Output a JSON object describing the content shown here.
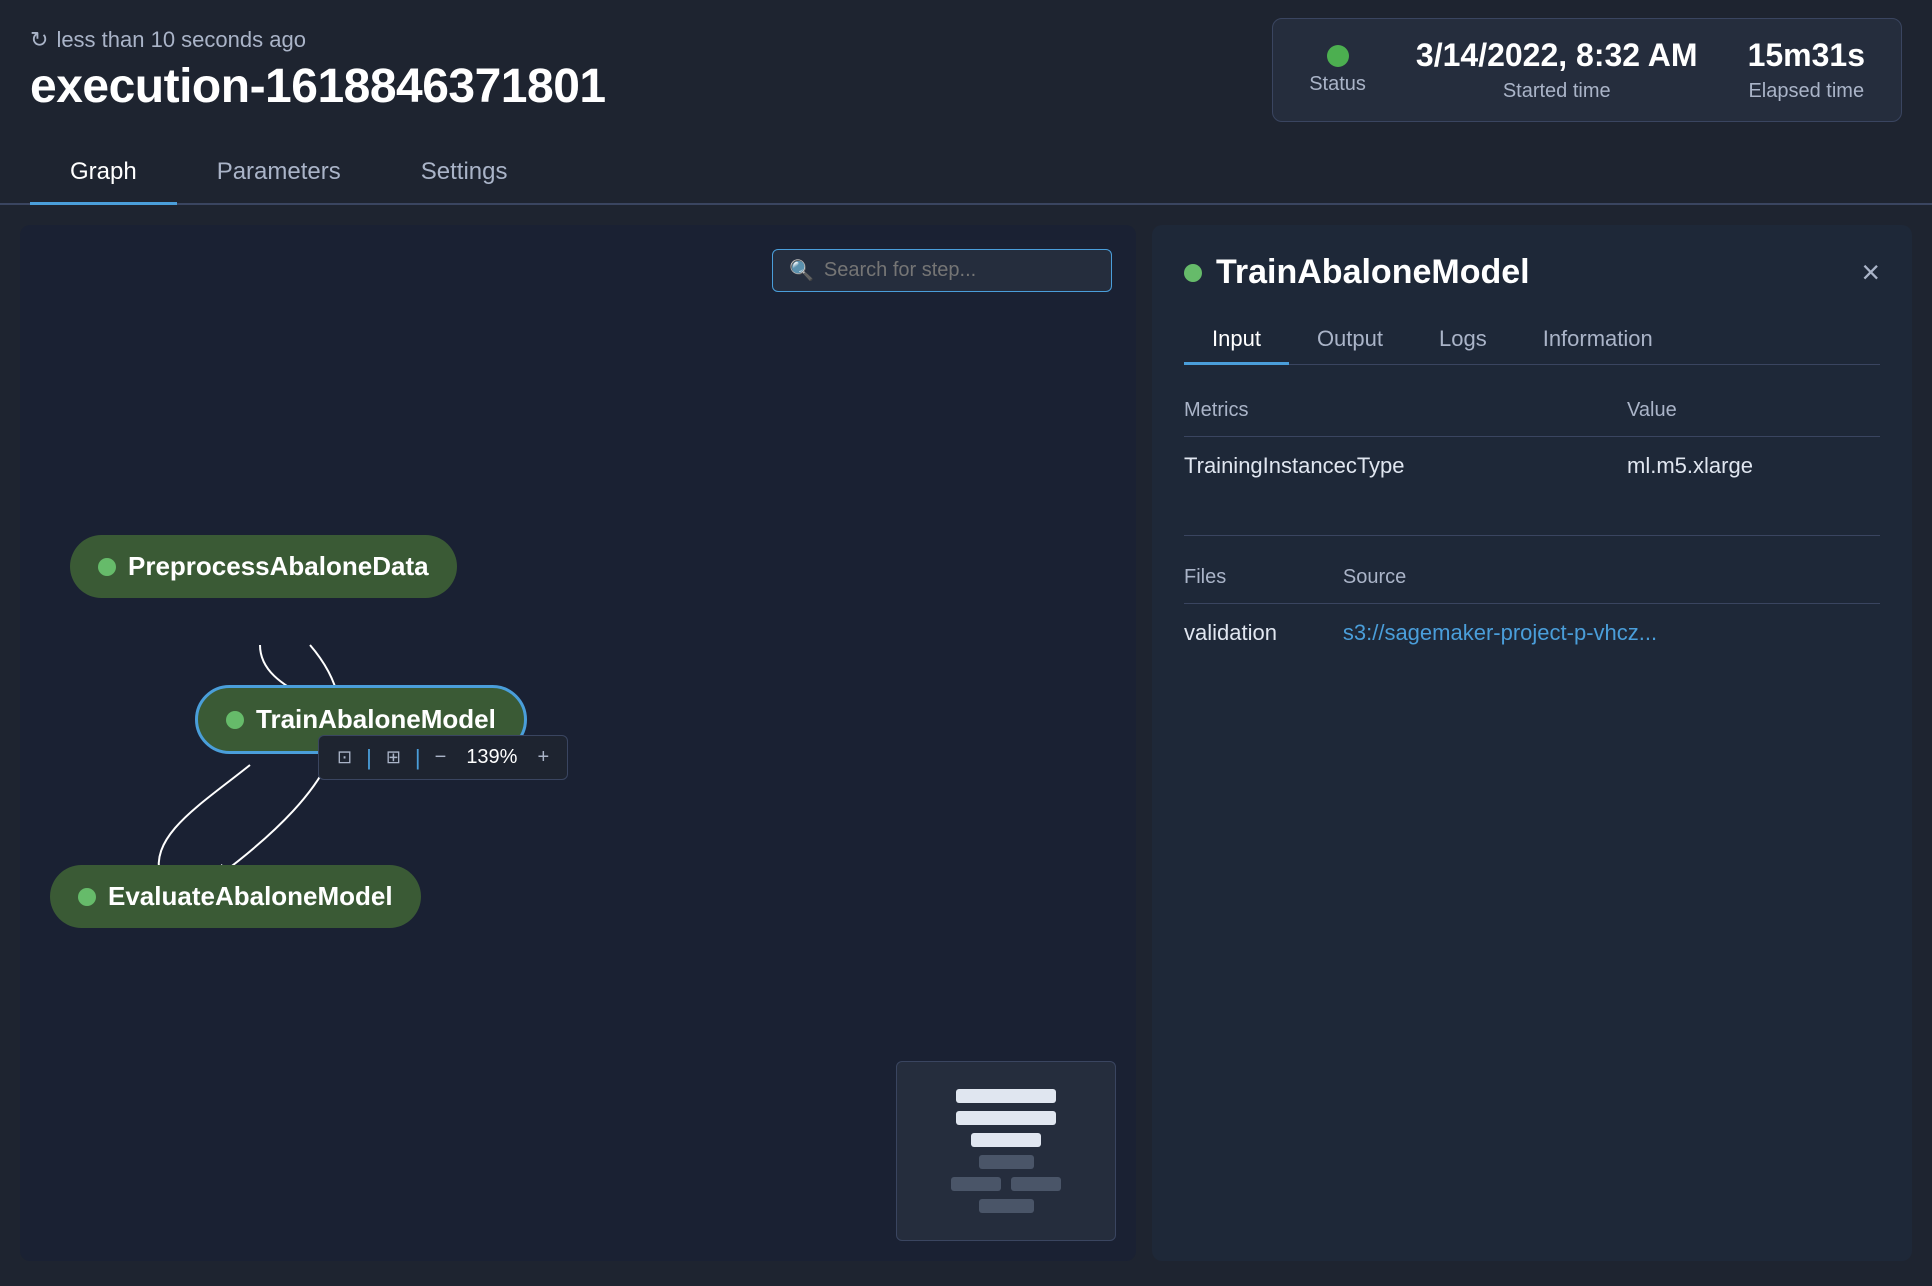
{
  "header": {
    "refresh_label": "less than 10 seconds ago",
    "page_title": "execution-1618846371801"
  },
  "status_box": {
    "status_label": "Status",
    "started_time_label": "Started time",
    "started_time_value": "3/14/2022, 8:32 AM",
    "elapsed_time_label": "Elapsed time",
    "elapsed_time_value": "15m31s"
  },
  "tabs": [
    {
      "label": "Graph",
      "active": true
    },
    {
      "label": "Parameters",
      "active": false
    },
    {
      "label": "Settings",
      "active": false
    }
  ],
  "graph": {
    "search_placeholder": "Search for step...",
    "nodes": [
      {
        "label": "PreprocessAbaloneData",
        "selected": false
      },
      {
        "label": "TrainAbaloneModel",
        "selected": true
      },
      {
        "label": "EvaluateAbaloneModel",
        "selected": false
      }
    ],
    "zoom_value": "139%"
  },
  "detail_panel": {
    "title": "TrainAbaloneModel",
    "tabs": [
      {
        "label": "Input",
        "active": true
      },
      {
        "label": "Output",
        "active": false
      },
      {
        "label": "Logs",
        "active": false
      },
      {
        "label": "Information",
        "active": false
      }
    ],
    "metrics_header": "Metrics",
    "value_header": "Value",
    "rows": [
      {
        "metric": "TrainingInstancecType",
        "value": "ml.m5.xlarge"
      }
    ],
    "files_header": "Files",
    "source_header": "Source",
    "file_rows": [
      {
        "file": "validation",
        "source": "s3://sagemaker-project-p-vhcz..."
      }
    ],
    "close_label": "×"
  },
  "zoom_toolbar": {
    "fit_icon": "⊡",
    "center_icon": "⊞",
    "minus_label": "−",
    "plus_label": "+",
    "zoom_value": "139%"
  }
}
